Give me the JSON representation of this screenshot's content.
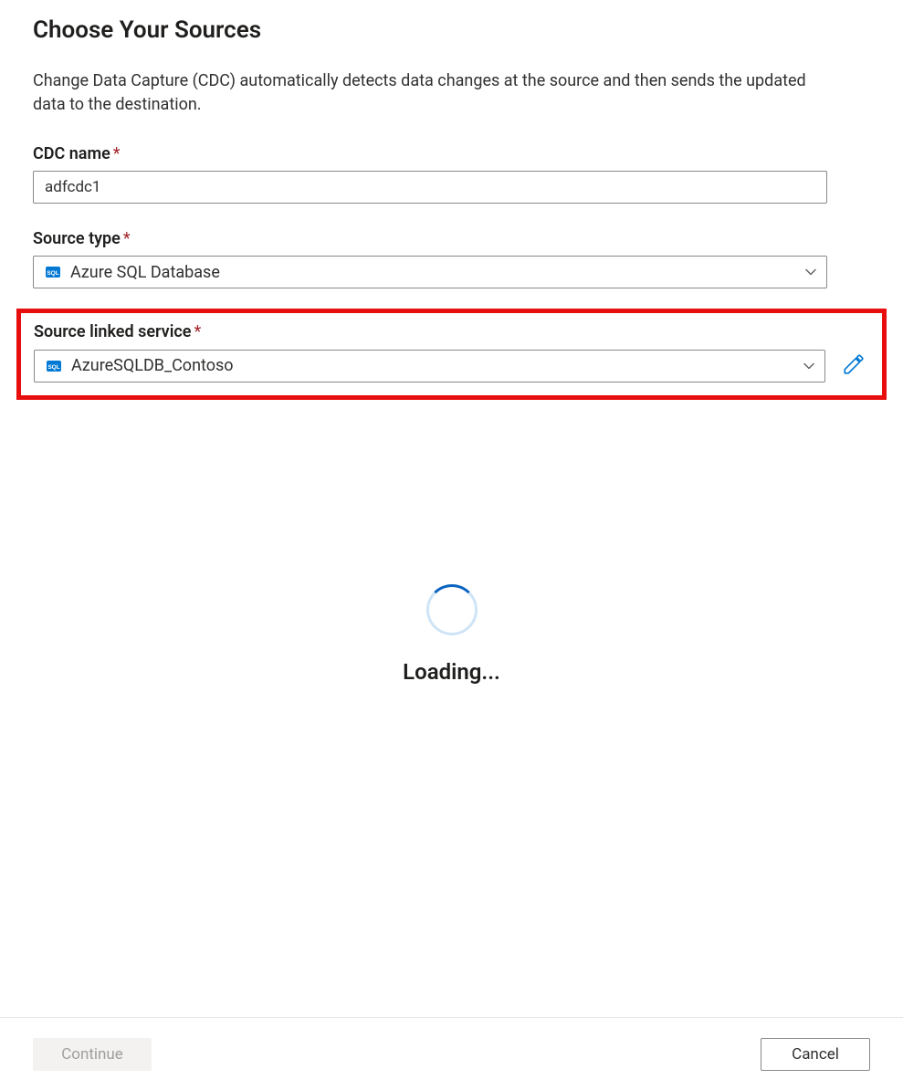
{
  "page": {
    "title": "Choose Your Sources",
    "description": "Change Data Capture (CDC) automatically detects data changes at the source and then sends the updated data to the destination."
  },
  "fields": {
    "cdc_name": {
      "label": "CDC name",
      "value": "adfcdc1"
    },
    "source_type": {
      "label": "Source type",
      "value": "Azure SQL Database",
      "icon": "sql-database-icon"
    },
    "linked_service": {
      "label": "Source linked service",
      "value": "AzureSQLDB_Contoso",
      "icon": "sql-database-icon"
    }
  },
  "status": {
    "loading_text": "Loading..."
  },
  "footer": {
    "continue_label": "Continue",
    "cancel_label": "Cancel"
  },
  "colors": {
    "highlight": "#e80e0e",
    "link": "#0078d4",
    "required": "#a4262c"
  }
}
